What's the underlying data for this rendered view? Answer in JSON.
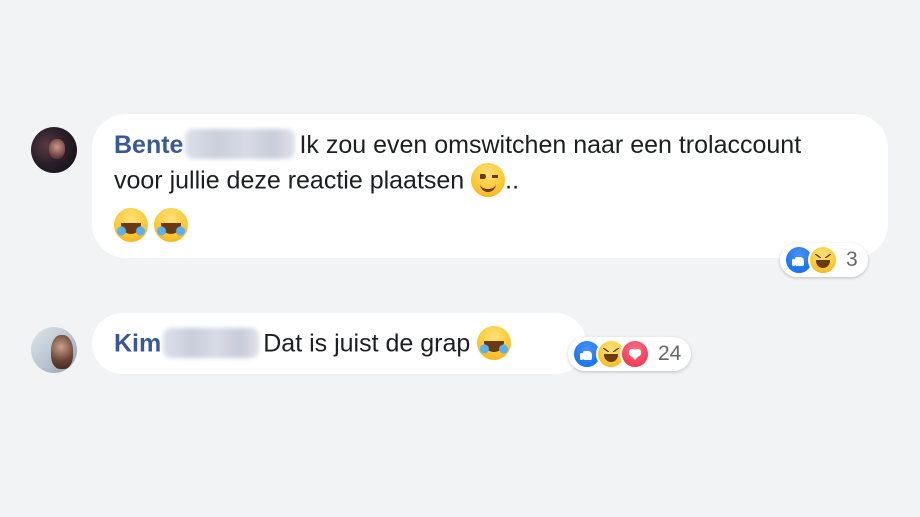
{
  "comments": [
    {
      "author": "Bente",
      "text": "Ik zou even omswitchen naar een trolaccount voor jullie deze reactie plaatsen",
      "trailing": "..",
      "inline_emoji": "wink-emoji",
      "attached_emojis": [
        "laughing-tears-emoji",
        "laughing-tears-emoji"
      ],
      "reactions": {
        "icons": [
          "like-icon",
          "haha-icon"
        ],
        "count": "3"
      }
    },
    {
      "author": "Kim",
      "text": "Dat is juist de grap",
      "inline_emoji": "laughing-tears-emoji",
      "reactions": {
        "icons": [
          "like-icon",
          "haha-icon",
          "love-icon"
        ],
        "count": "24"
      }
    }
  ],
  "colors": {
    "background": "#f2f3f5",
    "bubble": "#ffffff",
    "author_name": "#385898",
    "text": "#1c1e21",
    "count": "#65676b",
    "like": "#1877f2",
    "love": "#f33e58"
  }
}
